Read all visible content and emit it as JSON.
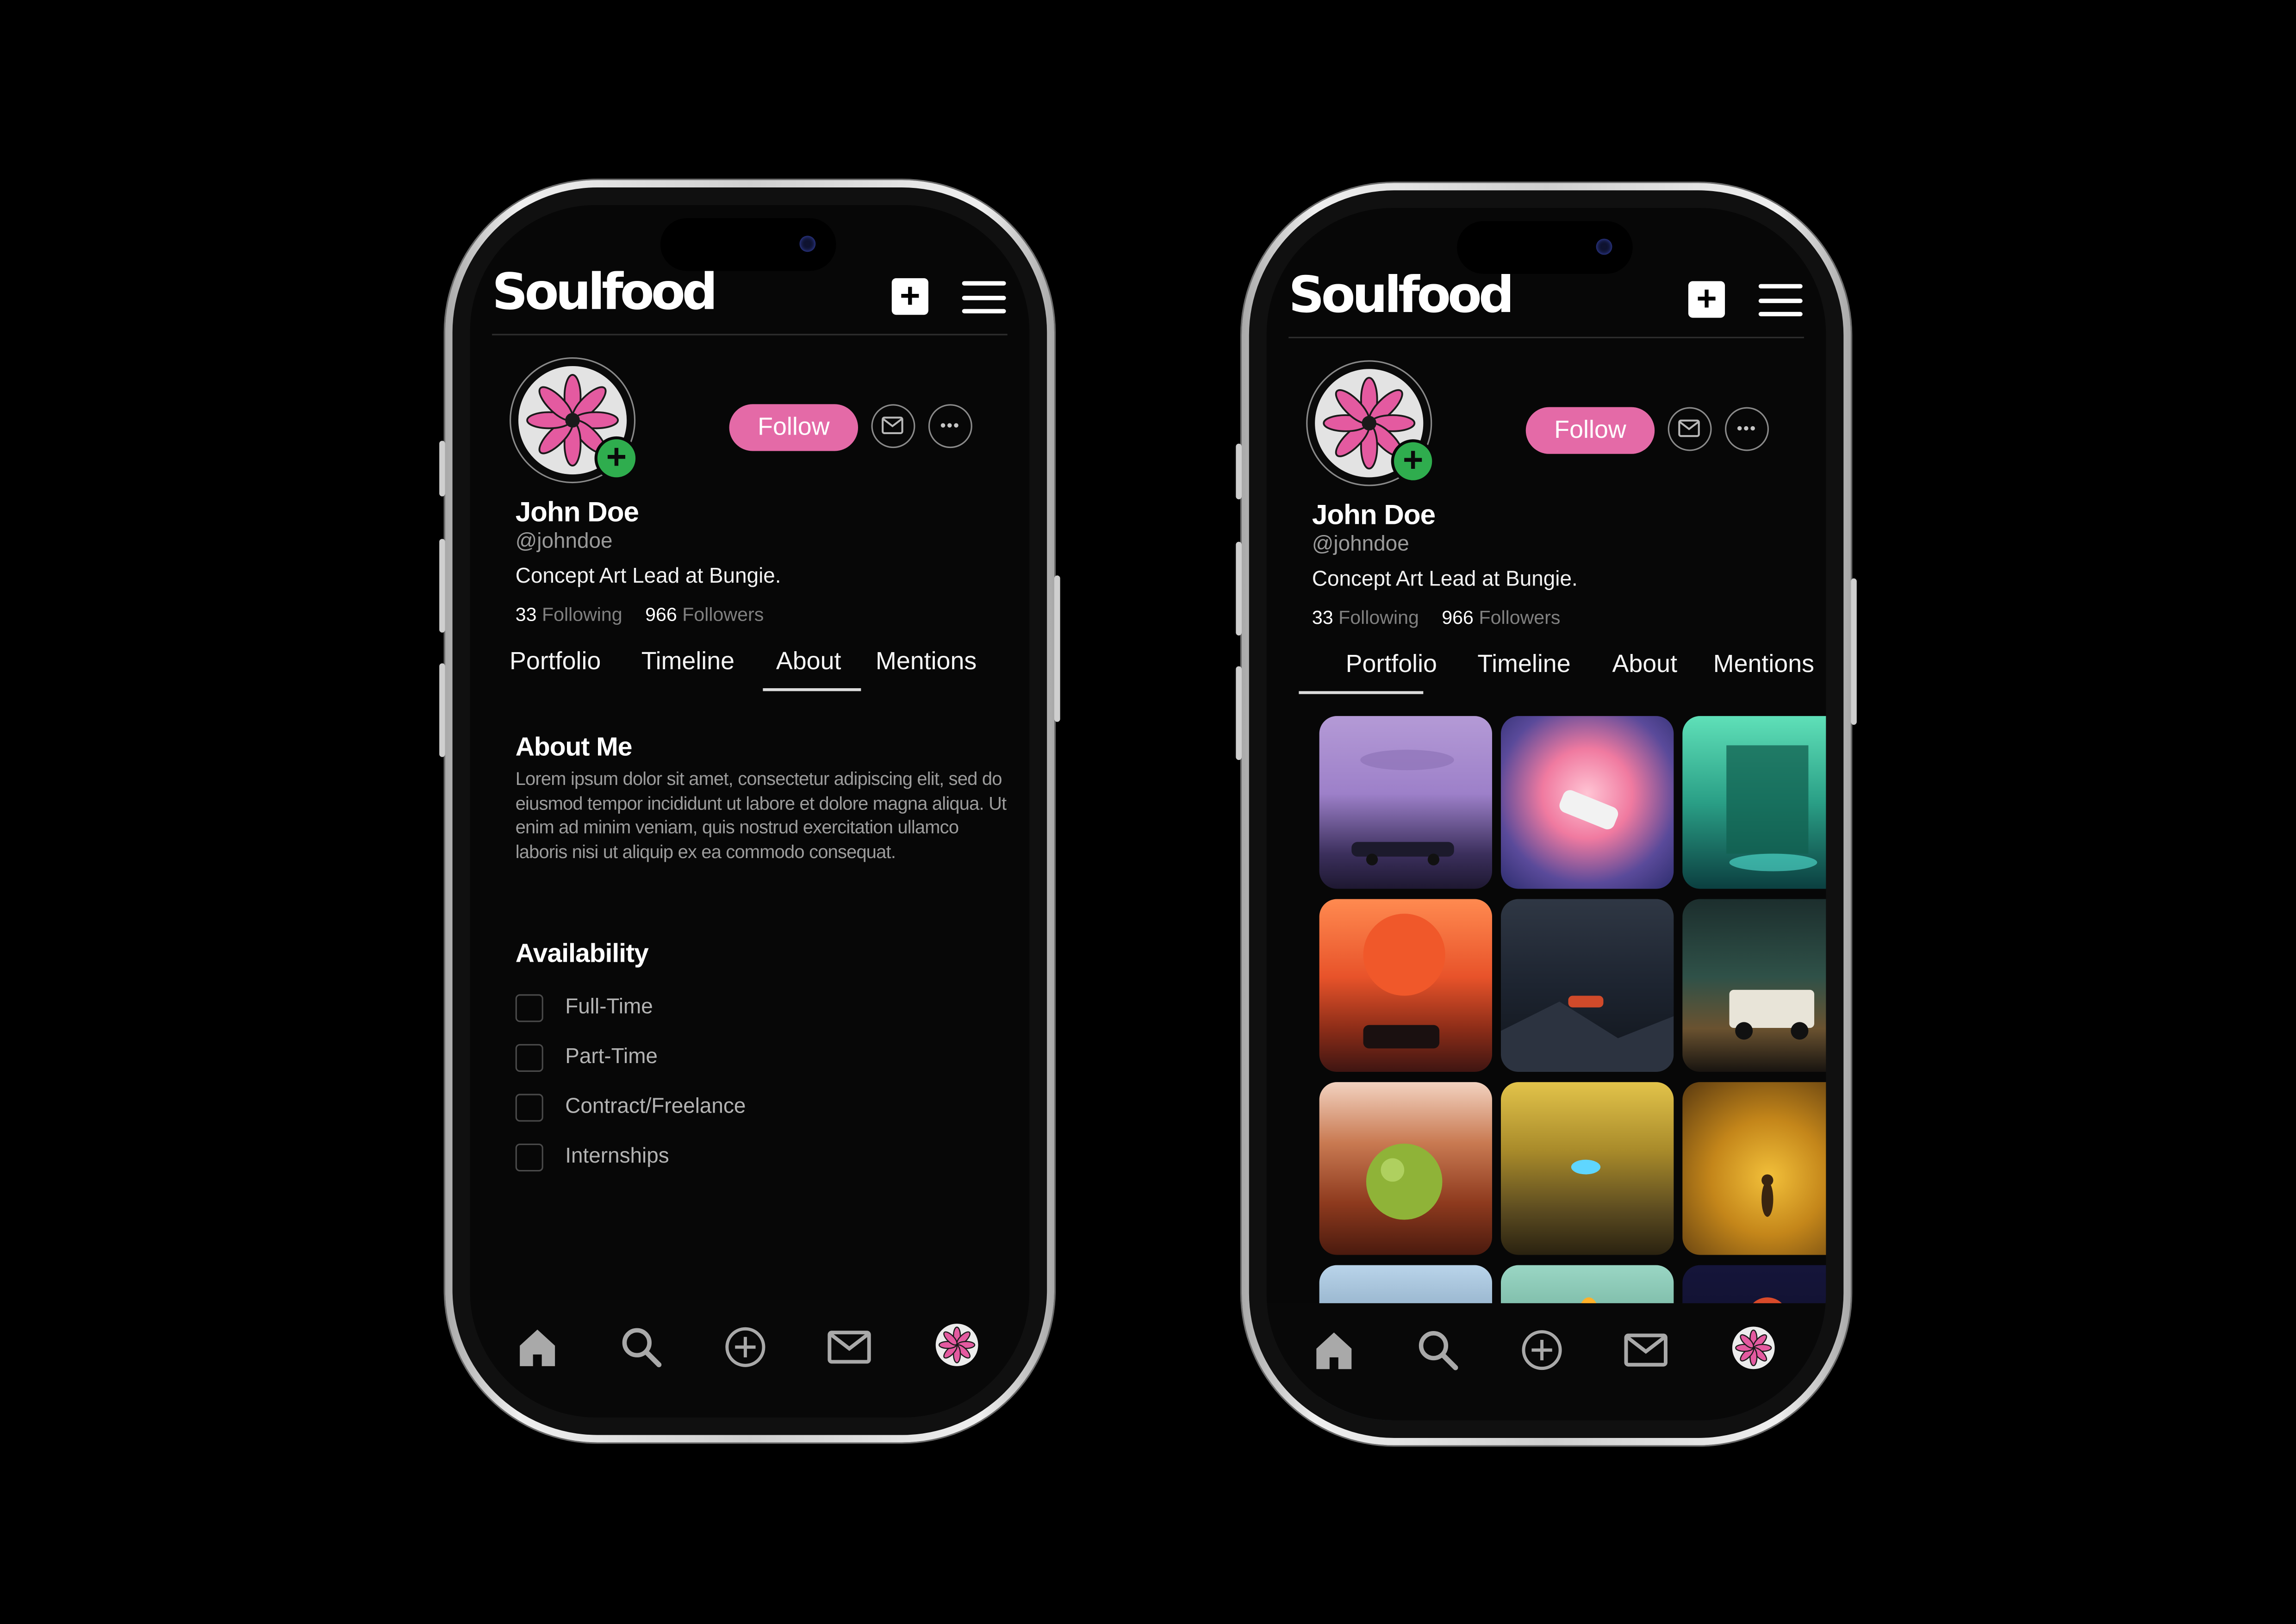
{
  "app": {
    "name": "Soulfood"
  },
  "colors": {
    "accent": "#e46aa7",
    "add_badge": "#2fad4e",
    "background": "#000000"
  },
  "icons": [
    "add-post-icon",
    "menu-icon",
    "mail-icon",
    "more-icon",
    "home-icon",
    "search-icon",
    "create-icon",
    "inbox-icon",
    "profile-avatar-icon",
    "flower-icon"
  ],
  "profile": {
    "name": "John Doe",
    "handle": "@johndoe",
    "bio": "Concept Art Lead at Bungie.",
    "following_count": "33",
    "following_label": "Following",
    "followers_count": "966",
    "followers_label": "Followers",
    "follow_label": "Follow"
  },
  "tabs": [
    "Portfolio",
    "Timeline",
    "About",
    "Mentions"
  ],
  "screens": [
    {
      "active_tab": "About",
      "about": {
        "title": "About Me",
        "text": "Lorem ipsum dolor sit amet, consectetur adipiscing elit, sed do eiusmod tempor incididunt ut labore et dolore magna aliqua. Ut enim ad minim veniam, quis nostrud exercitation ullamco laboris nisi ut aliquip ex ea commodo consequat."
      },
      "availability": {
        "title": "Availability",
        "options": [
          {
            "label": "Full-Time",
            "checked": false
          },
          {
            "label": "Part-Time",
            "checked": false
          },
          {
            "label": "Contract/Freelance",
            "checked": false
          },
          {
            "label": "Internships",
            "checked": false
          }
        ]
      }
    },
    {
      "active_tab": "Portfolio",
      "portfolio_count_visible": 12
    }
  ]
}
